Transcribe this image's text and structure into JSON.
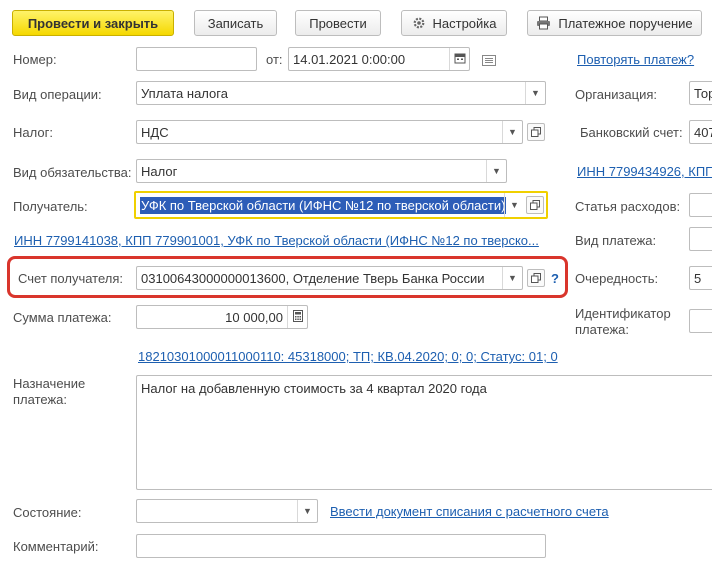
{
  "toolbar": {
    "post_close": "Провести и закрыть",
    "save": "Записать",
    "post": "Провести",
    "settings": "Настройка",
    "payment_order": "Платежное поручение"
  },
  "left": {
    "number_label": "Номер:",
    "number_value": "",
    "date_from_label": "от:",
    "date_value": "14.01.2021  0:00:00",
    "operation_label": "Вид операции:",
    "operation_value": "Уплата налога",
    "tax_label": "Налог:",
    "tax_value": "НДС",
    "obligation_label": "Вид обязательства:",
    "obligation_value": "Налог",
    "recipient_label": "Получатель:",
    "recipient_value": "УФК по Тверской области (ИФНС №12 по тверской области)",
    "recipient_link": "ИНН 7799141038, КПП 779901001, УФК по Тверской области (ИФНС №12 по тверско...",
    "account_label": "Счет получателя:",
    "account_value": "03100643000000013600, Отделение Тверь Банка России",
    "account_help": "?",
    "amount_label": "Сумма платежа:",
    "amount_value": "10 000,00",
    "kbk_link": "18210301000011000110: 45318000; ТП; КВ.04.2020; 0; 0; Статус: 01; 0",
    "purpose_label_1": "Назначение",
    "purpose_label_2": "платежа:",
    "purpose_value": "Налог на добавленную стоимость за 4 квартал 2020 года",
    "state_label": "Состояние:",
    "state_value": "",
    "state_link": "Ввести документ списания с расчетного счета",
    "comment_label": "Комментарий:",
    "comment_value": ""
  },
  "right": {
    "repeat_link": "Повторять платеж?",
    "org_label": "Организация:",
    "org_value": "Тор",
    "bank_label": "Банковский счет:",
    "bank_value": "407",
    "inn_link": "ИНН 7799434926, КПП",
    "expense_label": "Статья расходов:",
    "payment_type_label": "Вид платежа:",
    "priority_label": "Очередность:",
    "priority_value": "5",
    "identifier_label_1": "Идентификатор",
    "identifier_label_2": "платежа:"
  },
  "colors": {
    "primary_button": "#f5d800",
    "link": "#1d5fb0",
    "highlight_border": "#d9352c",
    "focus_border": "#f0d000",
    "selection": "#2d5db8"
  },
  "icons": {
    "settings": "gear-icon",
    "payment_order": "printer-icon",
    "calendar": "calendar-icon",
    "calculator": "calculator-icon",
    "open": "open-window-icon",
    "dropdown": "chevron-down-icon"
  }
}
